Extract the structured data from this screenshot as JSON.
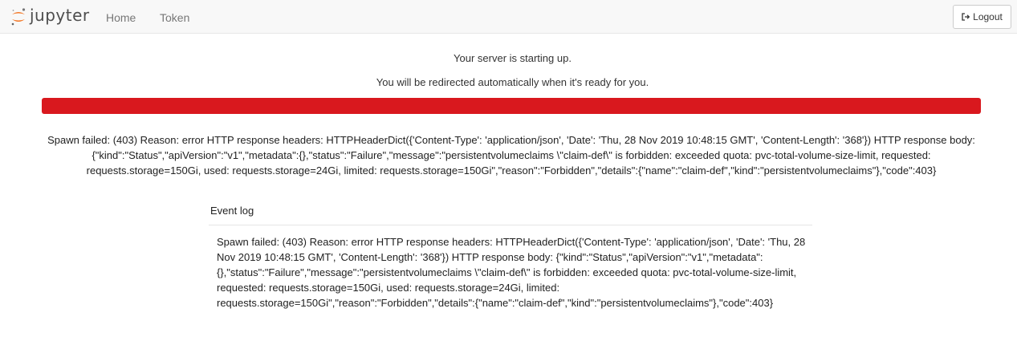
{
  "navbar": {
    "brand_text": "jupyter",
    "links": [
      "Home",
      "Token"
    ],
    "logout_label": "Logout"
  },
  "progress": {
    "message_line1": "Your server is starting up.",
    "message_line2": "You will be redirected automatically when it's ready for you.",
    "percent": 100,
    "bar_color": "#d9181e",
    "spawn_message": "Spawn failed: (403) Reason: error HTTP response headers: HTTPHeaderDict({'Content-Type': 'application/json', 'Date': 'Thu, 28 Nov 2019 10:48:15 GMT', 'Content-Length': '368'}) HTTP response body: {\"kind\":\"Status\",\"apiVersion\":\"v1\",\"metadata\":{},\"status\":\"Failure\",\"message\":\"persistentvolumeclaims \\\"claim-def\\\" is forbidden: exceeded quota: pvc-total-volume-size-limit, requested: requests.storage=150Gi, used: requests.storage=24Gi, limited: requests.storage=150Gi\",\"reason\":\"Forbidden\",\"details\":{\"name\":\"claim-def\",\"kind\":\"persistentvolumeclaims\"},\"code\":403}"
  },
  "event_log": {
    "title": "Event log",
    "entries": [
      "Spawn failed: (403) Reason: error HTTP response headers: HTTPHeaderDict({'Content-Type': 'application/json', 'Date': 'Thu, 28 Nov 2019 10:48:15 GMT', 'Content-Length': '368'}) HTTP response body: {\"kind\":\"Status\",\"apiVersion\":\"v1\",\"metadata\":{},\"status\":\"Failure\",\"message\":\"persistentvolumeclaims \\\"claim-def\\\" is forbidden: exceeded quota: pvc-total-volume-size-limit, requested: requests.storage=150Gi, used: requests.storage=24Gi, limited: requests.storage=150Gi\",\"reason\":\"Forbidden\",\"details\":{\"name\":\"claim-def\",\"kind\":\"persistentvolumeclaims\"},\"code\":403}"
    ]
  },
  "icons": {
    "logo": "jupyter-logo-icon",
    "logout": "sign-out-icon"
  },
  "colors": {
    "brand_orange": "#f37726",
    "navbar_bg": "#f8f8f8"
  }
}
